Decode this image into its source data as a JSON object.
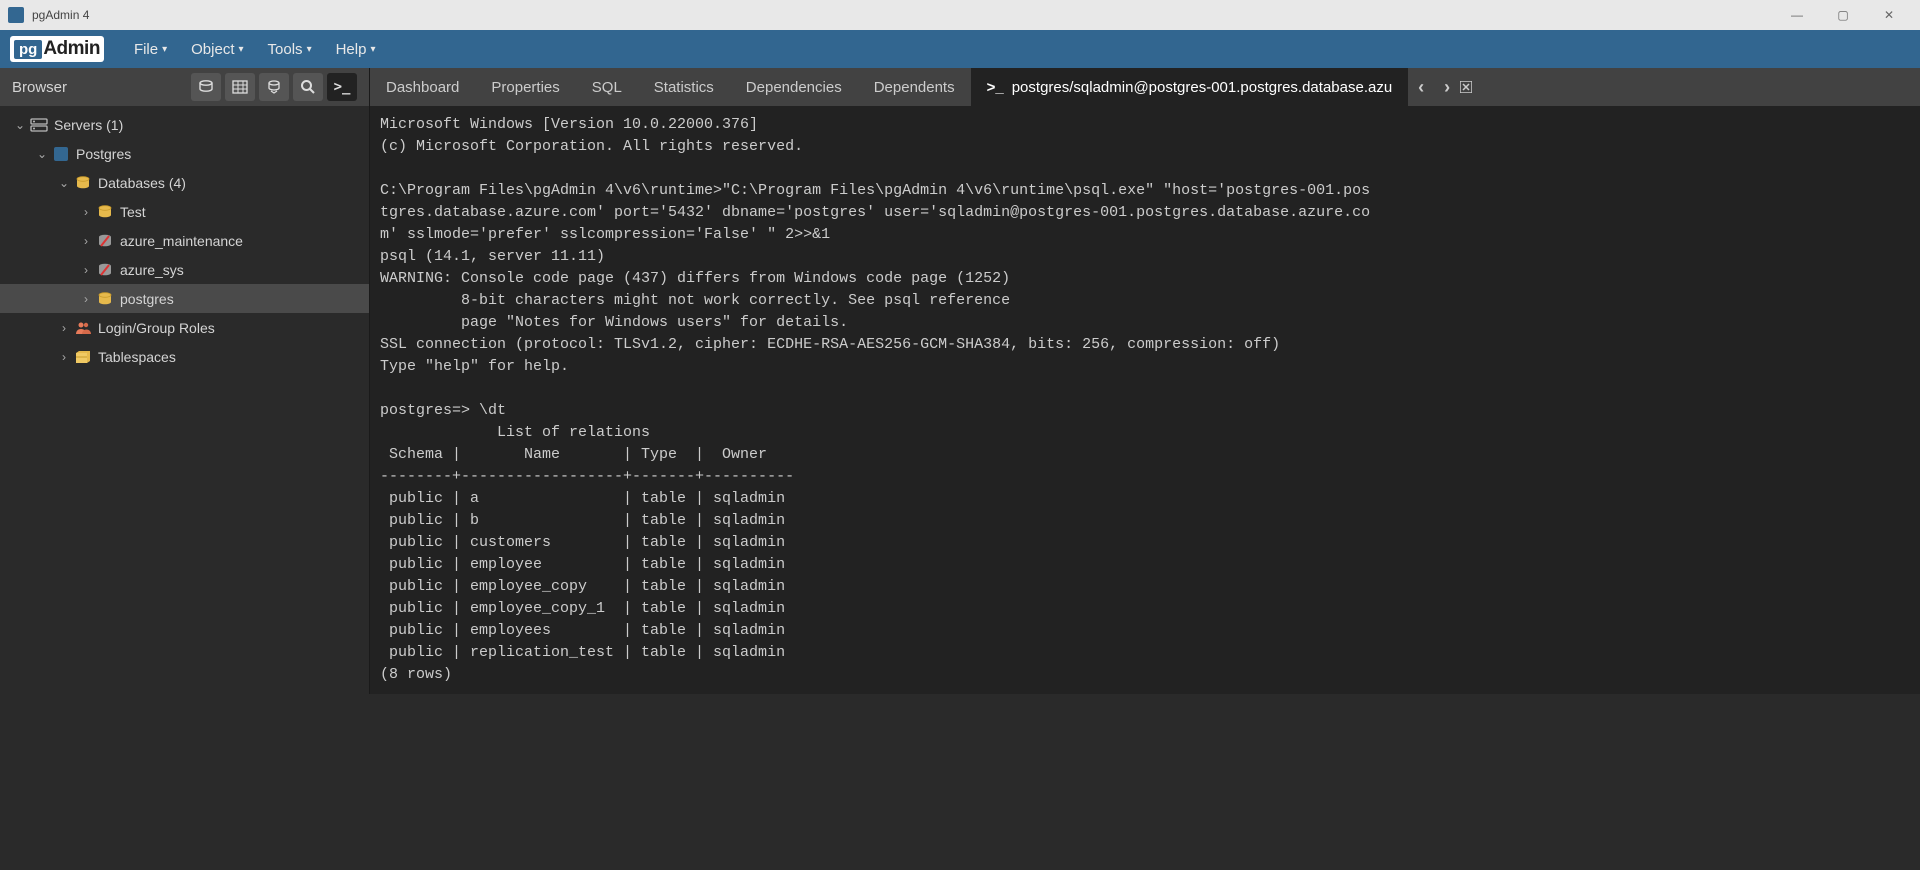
{
  "window": {
    "title": "pgAdmin 4"
  },
  "menu": {
    "items": [
      "File",
      "Object",
      "Tools",
      "Help"
    ]
  },
  "logo": {
    "pg": "pg",
    "admin": "Admin"
  },
  "sidebar": {
    "title": "Browser",
    "tree": [
      {
        "depth": 0,
        "toggle": "v",
        "iconType": "server",
        "label": "Servers (1)"
      },
      {
        "depth": 1,
        "toggle": "v",
        "iconType": "elephant",
        "label": "Postgres"
      },
      {
        "depth": 2,
        "toggle": "v",
        "iconType": "db-group",
        "label": "Databases (4)"
      },
      {
        "depth": 3,
        "toggle": ">",
        "iconType": "db",
        "label": "Test"
      },
      {
        "depth": 3,
        "toggle": ">",
        "iconType": "db-gray",
        "label": "azure_maintenance"
      },
      {
        "depth": 3,
        "toggle": ">",
        "iconType": "db-gray",
        "label": "azure_sys"
      },
      {
        "depth": 3,
        "toggle": ">",
        "iconType": "db",
        "label": "postgres",
        "selected": true
      },
      {
        "depth": 2,
        "toggle": ">",
        "iconType": "roles",
        "label": "Login/Group Roles"
      },
      {
        "depth": 2,
        "toggle": ">",
        "iconType": "tablespace",
        "label": "Tablespaces"
      }
    ]
  },
  "tabs": {
    "items": [
      {
        "label": "Dashboard"
      },
      {
        "label": "Properties"
      },
      {
        "label": "SQL"
      },
      {
        "label": "Statistics"
      },
      {
        "label": "Dependencies"
      },
      {
        "label": "Dependents"
      }
    ],
    "active": {
      "icon": ">_",
      "label": "postgres/sqladmin@postgres-001.postgres.database.azu"
    },
    "nav_prev": "‹",
    "nav_next": "›",
    "close_icon": "✕",
    "overflow": "⋯"
  },
  "terminal": {
    "lines": [
      "Microsoft Windows [Version 10.0.22000.376]",
      "(c) Microsoft Corporation. All rights reserved.",
      "",
      "C:\\Program Files\\pgAdmin 4\\v6\\runtime>\"C:\\Program Files\\pgAdmin 4\\v6\\runtime\\psql.exe\" \"host='postgres-001.pos",
      "tgres.database.azure.com' port='5432' dbname='postgres' user='sqladmin@postgres-001.postgres.database.azure.co",
      "m' sslmode='prefer' sslcompression='False' \" 2>>&1",
      "psql (14.1, server 11.11)",
      "WARNING: Console code page (437) differs from Windows code page (1252)",
      "         8-bit characters might not work correctly. See psql reference",
      "         page \"Notes for Windows users\" for details.",
      "SSL connection (protocol: TLSv1.2, cipher: ECDHE-RSA-AES256-GCM-SHA384, bits: 256, compression: off)",
      "Type \"help\" for help.",
      "",
      "postgres=> \\dt",
      "             List of relations",
      " Schema |       Name       | Type  |  Owner",
      "--------+------------------+-------+----------",
      " public | a                | table | sqladmin",
      " public | b                | table | sqladmin",
      " public | customers        | table | sqladmin",
      " public | employee         | table | sqladmin",
      " public | employee_copy    | table | sqladmin",
      " public | employee_copy_1  | table | sqladmin",
      " public | employees        | table | sqladmin",
      " public | replication_test | table | sqladmin",
      "(8 rows)"
    ]
  }
}
